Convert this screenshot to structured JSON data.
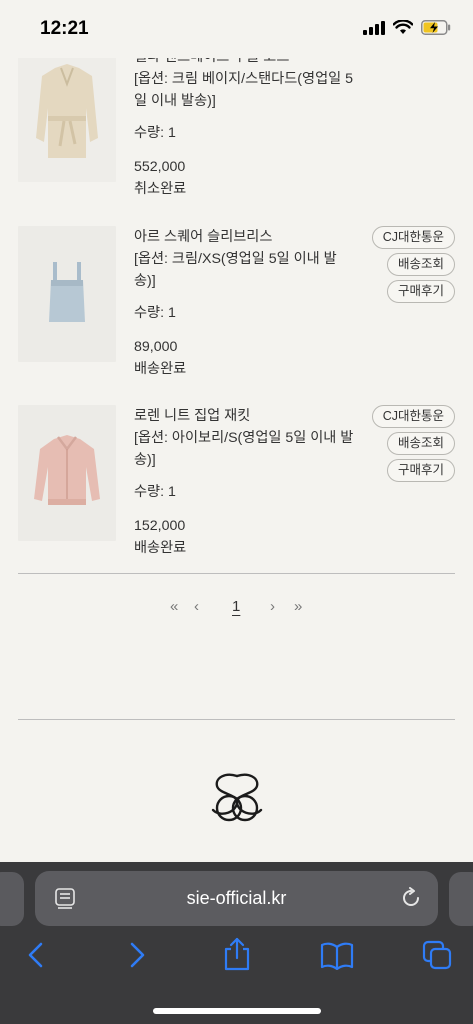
{
  "status_bar": {
    "time": "12:21"
  },
  "orders": [
    {
      "name": "벨라 핸드메이드 부클 코트",
      "option": "[옵션: 크림 베이지/스탠다드(영업일 5일 이내 발송)]",
      "qty": "수량: 1",
      "price": "552,000",
      "status": "취소완료",
      "actions": []
    },
    {
      "name": "아르 스퀘어 슬리브리스",
      "option": "[옵션: 크림/XS(영업일 5일 이내 발송)]",
      "qty": "수량: 1",
      "price": "89,000",
      "status": "배송완료",
      "actions": [
        "CJ대한통운",
        "배송조회",
        "구매후기"
      ]
    },
    {
      "name": "로렌 니트 집업 재킷",
      "option": "[옵션: 아이보리/S(영업일 5일 이내 발송)]",
      "qty": "수량: 1",
      "price": "152,000",
      "status": "배송완료",
      "actions": [
        "CJ대한통운",
        "배송조회",
        "구매후기"
      ]
    }
  ],
  "pagination": {
    "first": "«",
    "prev": "‹",
    "current": "1",
    "next": "›",
    "last": "»"
  },
  "browser": {
    "url": "sie-official.kr"
  },
  "colors": {
    "background": "#f4f3ef",
    "browser_bar": "#3a3a3c",
    "ios_blue": "#2f7cf6"
  },
  "icons": [
    "signal-icon",
    "wifi-icon",
    "battery-charging-icon",
    "reader-icon",
    "reload-icon",
    "back-icon",
    "forward-icon",
    "share-icon",
    "bookmarks-icon",
    "tabs-icon",
    "brand-logo"
  ]
}
